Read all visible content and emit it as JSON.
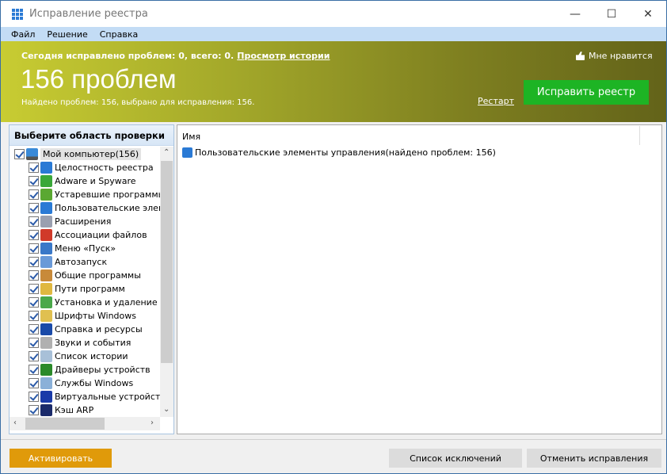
{
  "window": {
    "title": "Исправление реестра",
    "minimize": "—",
    "maximize": "☐",
    "close": "✕"
  },
  "menu": [
    "Файл",
    "Решение",
    "Справка"
  ],
  "banner": {
    "today_text": "Сегодня исправлено проблем: 0, всего: 0.",
    "history_link": "Просмотр истории",
    "count_title": "156 проблем",
    "summary": "Найдено проблем: 156, выбрано для исправления: 156.",
    "like": "Мне нравится",
    "restart": "Рестарт",
    "fix_button": "Исправить реестр",
    "fix_color": "#1db424"
  },
  "scan_area": {
    "header": "Выберите область проверки",
    "root": {
      "label": "Мой компьютер(156)",
      "checked": true,
      "icon": "computer-icon"
    },
    "items": [
      {
        "label": "Целостность реестра",
        "checked": true,
        "icon": "registry-icon",
        "color": "#2a7ad5"
      },
      {
        "label": "Adware и Spyware",
        "checked": true,
        "icon": "shield-icon",
        "color": "#3aa83a"
      },
      {
        "label": "Устаревшие программы",
        "checked": true,
        "icon": "trash-icon",
        "color": "#5aa832"
      },
      {
        "label": "Пользовательские элементы управления",
        "checked": true,
        "icon": "controls-icon",
        "color": "#2a7ad5"
      },
      {
        "label": "Расширения",
        "checked": true,
        "icon": "document-icon",
        "color": "#9aa0b0"
      },
      {
        "label": "Ассоциации файлов",
        "checked": true,
        "icon": "letter-a-icon",
        "color": "#d03a2a"
      },
      {
        "label": "Меню «Пуск»",
        "checked": true,
        "icon": "start-menu-icon",
        "color": "#3a78c8"
      },
      {
        "label": "Автозапуск",
        "checked": true,
        "icon": "autorun-icon",
        "color": "#6a9ad8"
      },
      {
        "label": "Общие программы",
        "checked": true,
        "icon": "handshake-icon",
        "color": "#c88a3a"
      },
      {
        "label": "Пути программ",
        "checked": true,
        "icon": "folder-computer-icon",
        "color": "#e0b840"
      },
      {
        "label": "Установка и удаление программ",
        "checked": true,
        "icon": "recycle-icon",
        "color": "#4aa84a"
      },
      {
        "label": "Шрифты Windows",
        "checked": true,
        "icon": "fonts-folder-icon",
        "color": "#e0c050"
      },
      {
        "label": "Справка и ресурсы",
        "checked": true,
        "icon": "help-icon",
        "color": "#1a4aa8"
      },
      {
        "label": "Звуки и события",
        "checked": true,
        "icon": "sound-icon",
        "color": "#b0b0b0"
      },
      {
        "label": "Список истории",
        "checked": true,
        "icon": "history-icon",
        "color": "#a8c0d8"
      },
      {
        "label": "Драйверы устройств",
        "checked": true,
        "icon": "driver-icon",
        "color": "#2a8a2a"
      },
      {
        "label": "Службы Windows",
        "checked": true,
        "icon": "services-icon",
        "color": "#8ab0d8"
      },
      {
        "label": "Виртуальные устройства",
        "checked": true,
        "icon": "virtual-device-icon",
        "color": "#1a3aa8"
      },
      {
        "label": "Кэш ARP",
        "checked": true,
        "icon": "footprints-icon",
        "color": "#1a2a6a"
      }
    ]
  },
  "results": {
    "column": "Имя",
    "items": [
      "Пользовательские элементы управления(найдено проблем: 156)"
    ]
  },
  "footer": {
    "activate": "Активировать",
    "activate_color": "#e09a0a",
    "exclusions": "Список исключений",
    "undo": "Отменить исправления"
  }
}
